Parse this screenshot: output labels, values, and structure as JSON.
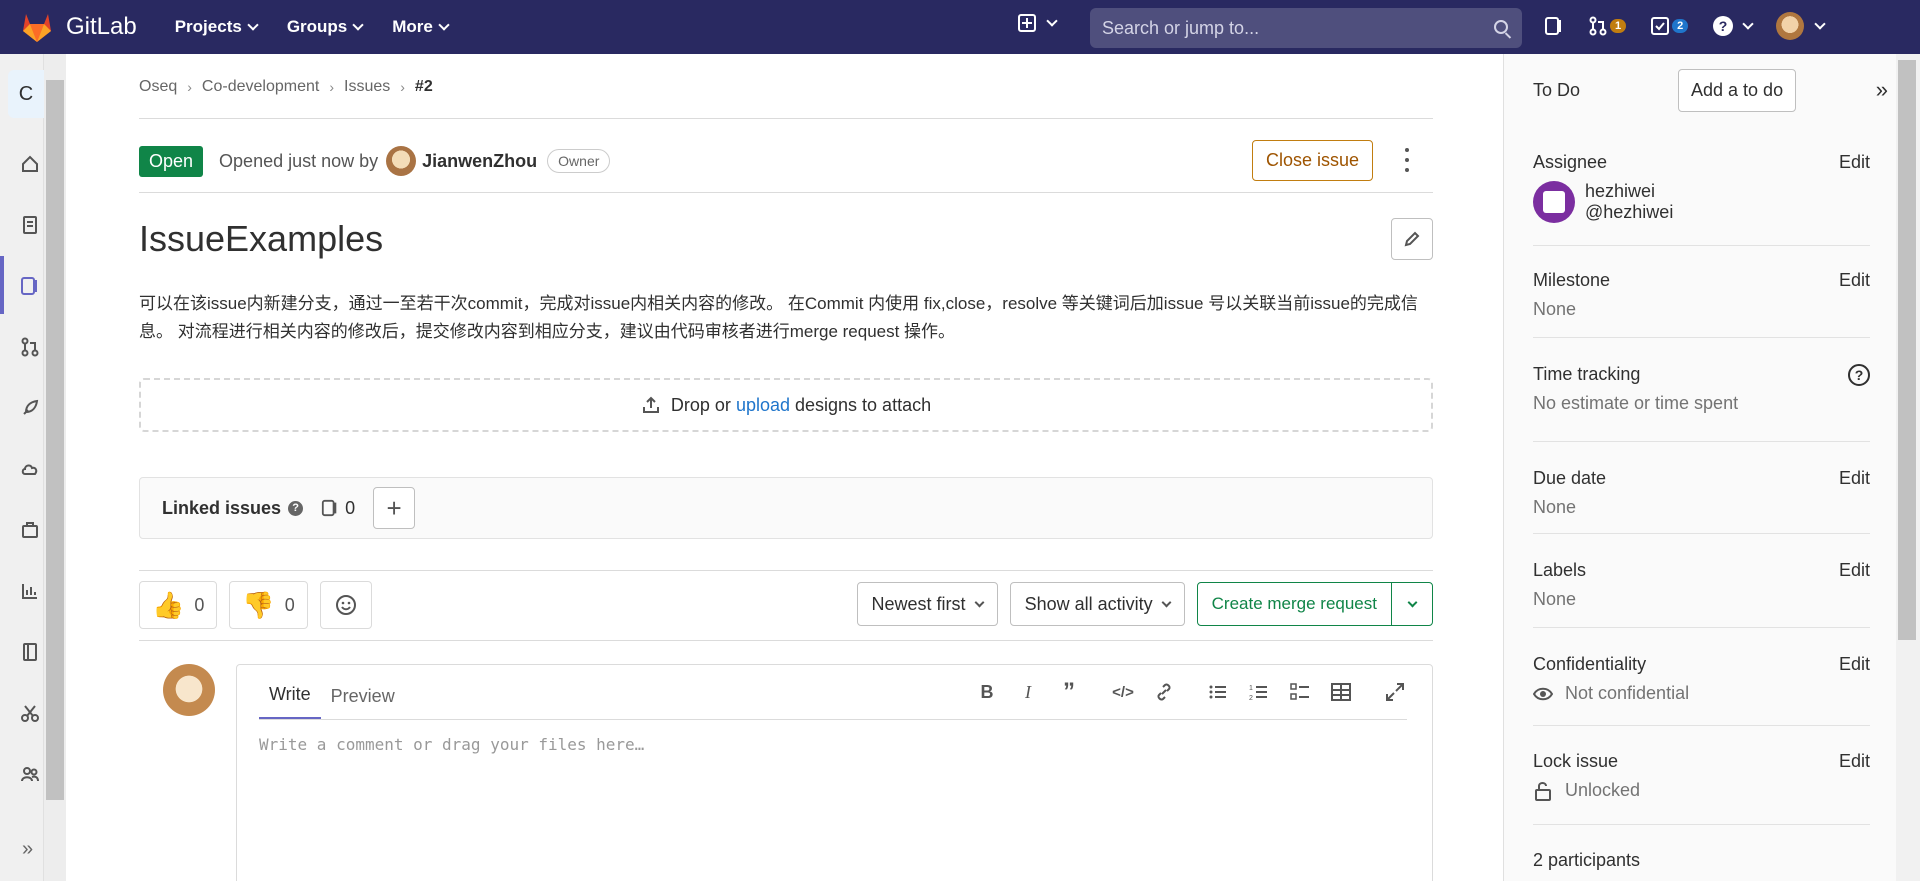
{
  "topnav": {
    "brand": "GitLab",
    "menu": [
      {
        "label": "Projects"
      },
      {
        "label": "Groups"
      },
      {
        "label": "More"
      }
    ],
    "search_placeholder": "Search or jump to...",
    "merge_requests_count": "1",
    "todos_count": "2"
  },
  "left_sidebar": {
    "project_initial": "C"
  },
  "breadcrumb": [
    "Oseq",
    "Co-development",
    "Issues",
    "#2"
  ],
  "issue": {
    "status": "Open",
    "opened_text": "Opened just now by",
    "author": "JianwenZhou",
    "author_role": "Owner",
    "close_label": "Close issue",
    "title": "IssueExamples",
    "description": "可以在该issue内新建分支，通过一至若干次commit，完成对issue内相关内容的修改。 在Commit 内使用 fix,close，resolve 等关键词后加issue 号以关联当前issue的完成信息。 对流程进行相关内容的修改后，提交修改内容到相应分支，建议由代码审核者进行merge request 操作。",
    "dropzone": {
      "before": "Drop or",
      "link": "upload",
      "after": "designs to attach"
    }
  },
  "linked_issues": {
    "title": "Linked issues",
    "help": "?",
    "count": "0",
    "add": "+"
  },
  "reactions": {
    "thumbs_up": "0",
    "thumbs_down": "0"
  },
  "activity": {
    "sort_label": "Newest first",
    "filter_label": "Show all activity",
    "create_mr_label": "Create merge request"
  },
  "editor": {
    "tab_write": "Write",
    "tab_preview": "Preview",
    "placeholder": "Write a comment or drag your files here…"
  },
  "right_sidebar": {
    "todo_label": "To Do",
    "add_todo": "Add a to do",
    "edit_label": "Edit",
    "assignee": {
      "heading": "Assignee",
      "name": "hezhiwei",
      "username": "@hezhiwei"
    },
    "milestone": {
      "heading": "Milestone",
      "value": "None"
    },
    "time_tracking": {
      "heading": "Time tracking",
      "value": "No estimate or time spent",
      "help": "?"
    },
    "due_date": {
      "heading": "Due date",
      "value": "None"
    },
    "labels": {
      "heading": "Labels",
      "value": "None"
    },
    "confidentiality": {
      "heading": "Confidentiality",
      "value": "Not confidential"
    },
    "lock_issue": {
      "heading": "Lock issue",
      "value": "Unlocked"
    },
    "participants": "2 participants"
  }
}
